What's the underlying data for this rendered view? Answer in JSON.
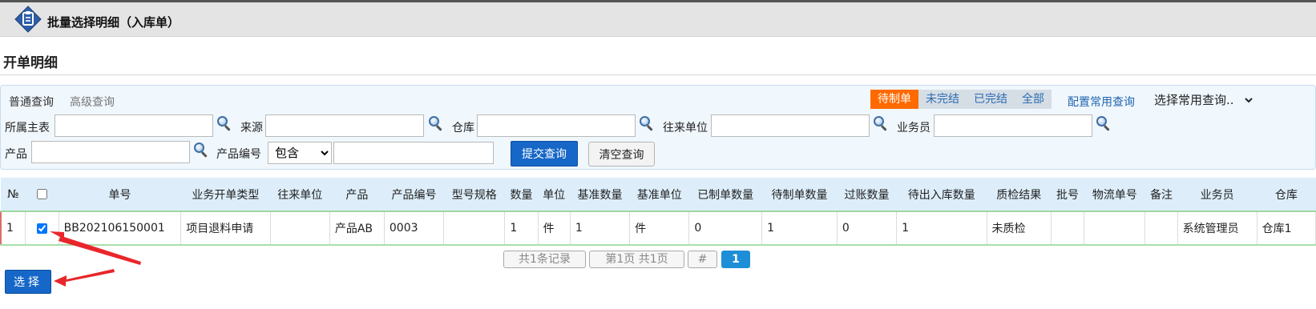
{
  "window": {
    "title": "批量选择明细（入库单）"
  },
  "section": {
    "title": "开单明细"
  },
  "query": {
    "tabs": [
      "普通查询",
      "高级查询"
    ],
    "status_tabs": [
      "待制单",
      "未完结",
      "已完结",
      "全部"
    ],
    "config_link": "配置常用查询",
    "common_query_select": "选择常用查询..",
    "fields": {
      "main_table": {
        "label": "所属主表",
        "value": ""
      },
      "source": {
        "label": "来源",
        "value": ""
      },
      "warehouse": {
        "label": "仓库",
        "value": ""
      },
      "partner": {
        "label": "往来单位",
        "value": ""
      },
      "salesman": {
        "label": "业务员",
        "value": ""
      },
      "product": {
        "label": "产品",
        "value": ""
      },
      "product_code": {
        "label": "产品编号",
        "operator": "包含",
        "value": ""
      }
    },
    "submit_label": "提交查询",
    "clear_label": "清空查询"
  },
  "table": {
    "headers": [
      "№",
      "",
      "单号",
      "业务开单类型",
      "往来单位",
      "产品",
      "产品编号",
      "型号规格",
      "数量",
      "单位",
      "基准数量",
      "基准单位",
      "已制单数量",
      "待制单数量",
      "过账数量",
      "待出入库数量",
      "质检结果",
      "批号",
      "物流单号",
      "备注",
      "业务员",
      "仓库"
    ],
    "rows": [
      [
        "1",
        "",
        "BB202106150001",
        "项目退料申请",
        "",
        "产品AB",
        "0003",
        "",
        "1",
        "件",
        "1",
        "件",
        "0",
        "1",
        "0",
        "1",
        "未质检",
        "",
        "",
        "",
        "系统管理员",
        "仓库1"
      ]
    ]
  },
  "pager": {
    "records": "共1条记录",
    "pages": "第1页 共1页",
    "hash": "#",
    "current": "1"
  },
  "actions": {
    "select_label": "选择"
  },
  "colors": {
    "accent": "#1667c7",
    "active_status": "#ff6a00",
    "annotation_arrow": "#e8262b"
  },
  "icons": {
    "title": "clipboard-icon",
    "lookup": "magnifier-icon",
    "annotation": "red-arrow-icon"
  }
}
